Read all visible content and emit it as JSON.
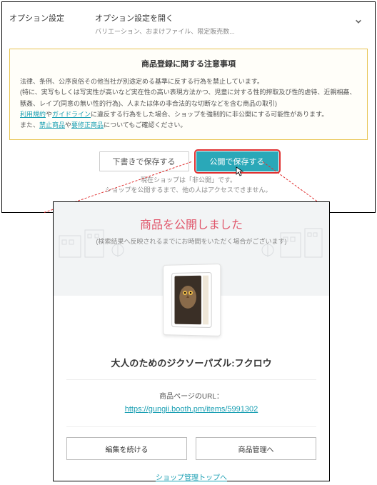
{
  "topPanel": {
    "optionLabel": "オプション設定",
    "optionOpen": "オプション設定を開く",
    "optionSub": "バリエーション、おまけファイル、限定販売数...",
    "notice": {
      "title": "商品登録に関する注意事項",
      "line1": "法律、条例、公序良俗その他当社が別途定める基準に反する行為を禁止しています。",
      "line2a": "(特に、実写もしくは写実性が高いなど実在性の高い表現方法かつ、児童に対する性的搾取及び性的虐待、近親相姦、獣姦、レイプ(同意の無い性的行為)、人または体の非合法的な切断などを含む商品の取引)",
      "line3a": "利用規約",
      "line3b": "や",
      "line3c": "ガイドライン",
      "line3d": "に違反する行為をした場合、ショップを強制的に非公開にする可能性があります。",
      "line4a": "また、",
      "line4b": "禁止商品",
      "line4c": "や",
      "line4d": "要修正商品",
      "line4e": "についてもご確認ください。"
    },
    "buttons": {
      "draft": "下書きで保存する",
      "publish": "公開で保存する"
    },
    "subNote1": "現在ショップは「非公開」です。",
    "subNote2": "ショップを公開するまで、他の人はアクセスできません。"
  },
  "modal": {
    "title": "商品を公開しました",
    "sub": "(検索結果へ反映されるまでにお時間をいただく場合がございます)",
    "productName": "大人のためのジクソーパズル:フクロウ",
    "urlLabel": "商品ページのURL：",
    "url": "https://gungii.booth.pm/items/5991302",
    "btnEdit": "編集を続ける",
    "btnManage": "商品管理へ",
    "topLink": "ショップ管理トップへ"
  }
}
